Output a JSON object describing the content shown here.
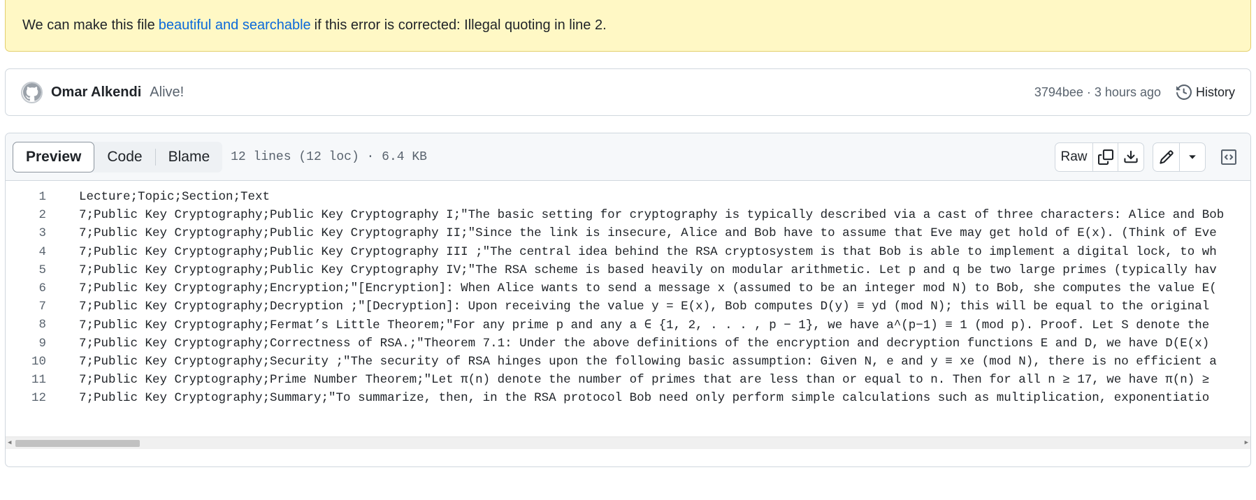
{
  "banner": {
    "prefix": "We can make this file",
    "link": "beautiful and searchable",
    "suffix": "if this error is corrected: Illegal quoting in line 2."
  },
  "commit": {
    "author": "Omar Alkendi",
    "message": "Alive!",
    "meta": "3794bee · 3 hours ago",
    "history_label": "History"
  },
  "file_header": {
    "tabs": [
      "Preview",
      "Code",
      "Blame"
    ],
    "active_tab": "Preview",
    "info": "12 lines (12 loc) · 6.4 KB",
    "raw_label": "Raw"
  },
  "lines": [
    {
      "n": "1",
      "text": "Lecture;Topic;Section;Text"
    },
    {
      "n": "2",
      "text": "7;Public Key Cryptography;Public Key Cryptography I;\"The basic setting for cryptography is typically described via a cast of three characters: Alice and Bob"
    },
    {
      "n": "3",
      "text": "7;Public Key Cryptography;Public Key Cryptography II;\"Since the link is insecure, Alice and Bob have to assume that Eve may get hold of E(x). (Think of Eve"
    },
    {
      "n": "4",
      "text": "7;Public Key Cryptography;Public Key Cryptography III ;\"The central idea behind the RSA cryptosystem is that Bob is able to implement a digital lock, to wh"
    },
    {
      "n": "5",
      "text": "7;Public Key Cryptography;Public Key Cryptography IV;\"The RSA scheme is based heavily on modular arithmetic. Let p and q be two large primes (typically hav"
    },
    {
      "n": "6",
      "text": "7;Public Key Cryptography;Encryption;\"[Encryption]: When Alice wants to send a message x (assumed to be an integer mod N) to Bob, she computes the value E("
    },
    {
      "n": "7",
      "text": "7;Public Key Cryptography;Decryption ;\"[Decryption]: Upon receiving the value y = E(x), Bob computes D(y) ≡ yd (mod N); this will be equal to the original"
    },
    {
      "n": "8",
      "text": "7;Public Key Cryptography;Fermat’s Little Theorem;\"For any prime p and any a ∈ {1, 2, . . . , p − 1}, we have a^(p−1) ≡ 1 (mod p). Proof. Let S denote the"
    },
    {
      "n": "9",
      "text": "7;Public Key Cryptography;Correctness of RSA.;\"Theorem 7.1: Under the above definitions of the encryption and decryption functions E and D, we have D(E(x)"
    },
    {
      "n": "10",
      "text": "7;Public Key Cryptography;Security ;\"The security of RSA hinges upon the following basic assumption: Given N, e and y ≡ xe (mod N), there is no efficient a"
    },
    {
      "n": "11",
      "text": "7;Public Key Cryptography;Prime Number Theorem;\"Let π(n) denote the number of primes that are less than or equal to n. Then for all n ≥ 17, we have π(n) ≥"
    },
    {
      "n": "12",
      "text": "7;Public Key Cryptography;Summary;\"To summarize, then, in the RSA protocol Bob need only perform simple calculations such as multiplication, exponentiatio"
    }
  ]
}
